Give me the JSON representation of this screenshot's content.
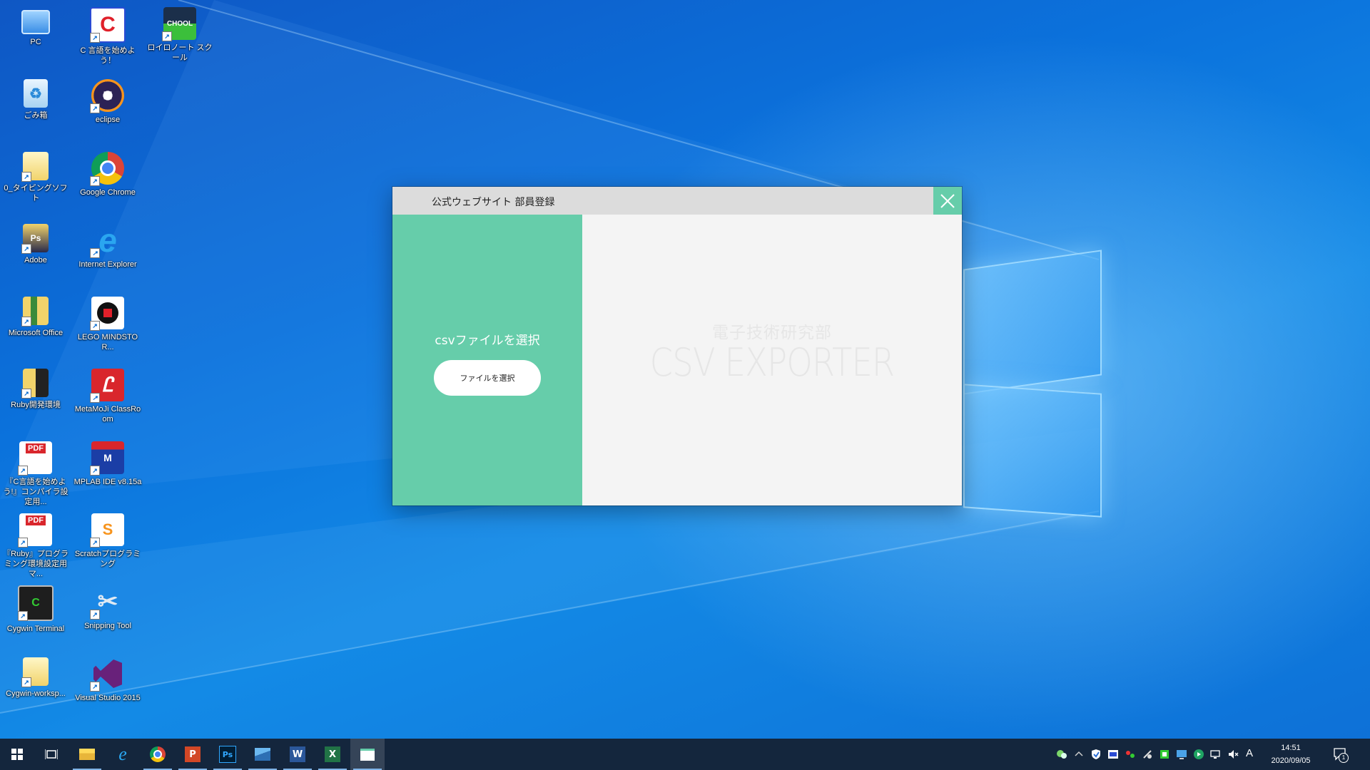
{
  "desktop_icons": [
    {
      "label": "PC"
    },
    {
      "label": "C 言語を始めよう！"
    },
    {
      "label": "ロイロノート スクール"
    },
    {
      "label": "ごみ箱"
    },
    {
      "label": "eclipse"
    },
    {
      "label": "0_タイピングソフト"
    },
    {
      "label": "Google Chrome"
    },
    {
      "label": "Adobe"
    },
    {
      "label": "Internet Explorer"
    },
    {
      "label": "Microsoft Office"
    },
    {
      "label": "LEGO MINDSTOR..."
    },
    {
      "label": "Ruby開発環境"
    },
    {
      "label": "MetaMoJi ClassRoom"
    },
    {
      "label": "『C言語を始めよう!』コンパイラ設定用..."
    },
    {
      "label": "MPLAB IDE v8.15a"
    },
    {
      "label": "『Ruby』プログラミング環境設定用マ..."
    },
    {
      "label": "Scratchプログラミング"
    },
    {
      "label": "Cygwin Terminal"
    },
    {
      "label": "Snipping Tool"
    },
    {
      "label": "Cygwin-worksp..."
    },
    {
      "label": "Visual Studio 2015"
    }
  ],
  "window": {
    "title": "公式ウェブサイト 部員登録",
    "left_panel": {
      "prompt": "csvファイルを選択",
      "button_label": "ファイルを選択"
    },
    "right_panel": {
      "club_name": "電子技術研究部",
      "app_name": "CSV EXPORTER"
    },
    "accent_color": "#66cdaa"
  },
  "taskbar": {
    "apps": [
      "start",
      "task-view",
      "file-explorer",
      "internet-explorer",
      "chrome",
      "powerpoint",
      "photoshop",
      "photos",
      "word",
      "excel",
      "csv-exporter"
    ],
    "ime": "A",
    "time": "14:51",
    "date": "2020/09/05",
    "notification_count": "1"
  }
}
